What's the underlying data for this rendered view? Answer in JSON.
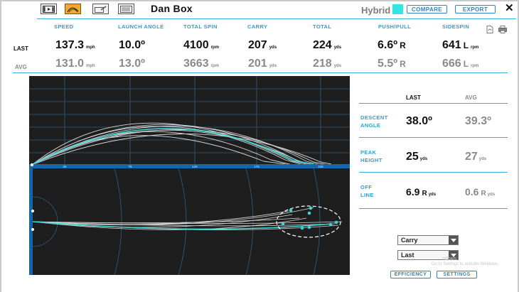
{
  "toolbar": {
    "buttons": [
      {
        "name": "play-icon"
      },
      {
        "name": "trajectory-icon"
      },
      {
        "name": "club-icon"
      },
      {
        "name": "keyboard-icon"
      }
    ]
  },
  "header": {
    "player_name": "Dan Box",
    "club_name": "Hybrid",
    "club_color": "#33e6e6",
    "compare_label": "COMPARE",
    "export_label": "EXPORT",
    "close_label": "✕"
  },
  "stats": {
    "row_last_label": "LAST",
    "row_avg_label": "AVG",
    "columns": [
      {
        "header": "SPEED",
        "last": "137.3",
        "last_unit": "mph",
        "avg": "131.0",
        "avg_unit": "mph"
      },
      {
        "header": "LAUNCH ANGLE",
        "last": "10.0º",
        "avg": "13.0º"
      },
      {
        "header": "TOTAL SPIN",
        "last": "4100",
        "last_unit": "rpm",
        "avg": "3663",
        "avg_unit": "rpm"
      },
      {
        "header": "CARRY",
        "last": "207",
        "last_unit": "yds",
        "avg": "201",
        "avg_unit": "yds"
      },
      {
        "header": "TOTAL",
        "last": "224",
        "last_unit": "yds",
        "avg": "218",
        "avg_unit": "yds"
      },
      {
        "header": "PUSH/PULL",
        "last": "6.6º",
        "last_dir": "R",
        "avg": "5.5º",
        "avg_dir": "R"
      },
      {
        "header": "SIDESPIN",
        "last": "641",
        "last_dir": "L",
        "last_unit": "rpm",
        "avg": "666",
        "avg_dir": "L",
        "avg_unit": "rpm"
      }
    ]
  },
  "side_icons": [
    "pdf-icon",
    "print-icon"
  ],
  "chart": {
    "distance_ticks": [
      "25",
      "75",
      "125",
      "175",
      "225"
    ]
  },
  "panel": {
    "last_header": "LAST",
    "avg_header": "AVG",
    "rows": [
      {
        "label_line1": "DESCENT",
        "label_line2": "ANGLE",
        "last": "38.0º",
        "avg": "39.3º"
      },
      {
        "label_line1": "PEAK",
        "label_line2": "HEIGHT",
        "last": "25",
        "last_unit": "yds",
        "avg": "27",
        "avg_unit": "yds"
      },
      {
        "label_line1": "OFF",
        "label_line2": "LINE",
        "last": "6.9",
        "last_dir": "R",
        "last_unit": "yds",
        "avg": "0.6",
        "avg_dir": "R",
        "avg_unit": "yds"
      }
    ]
  },
  "controls": {
    "metric_select": "Carry",
    "shot_select": "Last",
    "efficiency_label": "EFFICIENCY",
    "settings_label": "SETTINGS"
  },
  "watermark": {
    "line1": "ndows",
    "line2": "Go to Settings to activate Windows."
  }
}
